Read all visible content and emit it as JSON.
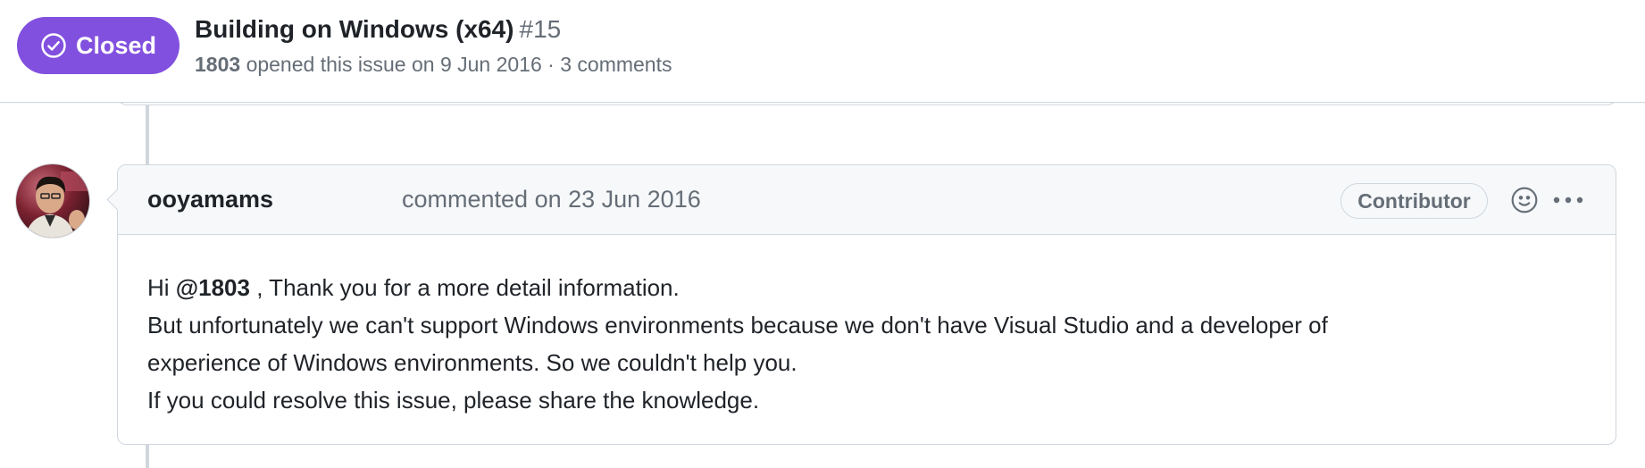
{
  "issue": {
    "state": "Closed",
    "title": "Building on Windows (x64)",
    "number": "#15",
    "author": "1803",
    "opened_text": "opened this issue on 9 Jun 2016",
    "separator": "·",
    "comments_count": "3 comments"
  },
  "comment": {
    "author": "ooyamams",
    "action": "commented on 23 Jun 2016",
    "role": "Contributor",
    "body": {
      "line1_prefix": "Hi ",
      "mention": "@1803",
      "line1_suffix": " , Thank you for a more detail information.",
      "line2": "But unfortunately we can't support Windows environments because we don't have Visual Studio and a developer of",
      "line3": "experience of Windows environments. So we couldn't help you.",
      "line4": "If you could resolve this issue, please share the knowledge."
    }
  },
  "icons": {
    "state": "check-circle-icon",
    "reaction": "smiley-icon",
    "more": "kebab-horizontal-icon"
  },
  "colors": {
    "closed_badge": "#8250df",
    "border": "#d0d7de",
    "header_bg": "#f6f8fa",
    "muted_text": "#656d76",
    "text": "#1f2328"
  }
}
